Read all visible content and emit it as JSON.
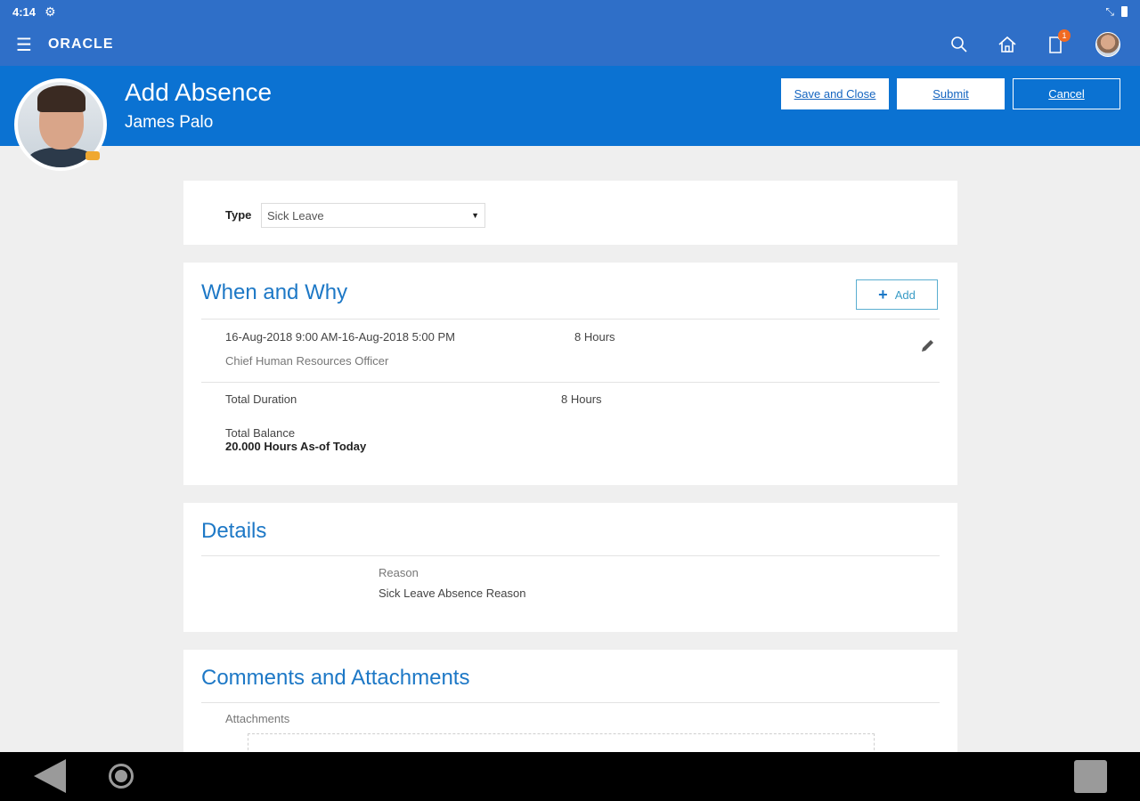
{
  "status_bar": {
    "time": "4:14"
  },
  "app_bar": {
    "logo": "ORACLE",
    "notification_count": "1"
  },
  "header": {
    "title": "Add Absence",
    "person_name": "James Palo",
    "buttons": {
      "save_close": "Save and Close",
      "submit": "Submit",
      "cancel": "Cancel"
    }
  },
  "type_section": {
    "label": "Type",
    "selected": "Sick Leave"
  },
  "when_why": {
    "title": "When and Why",
    "add_label": "Add",
    "entry": {
      "date_range": "16-Aug-2018 9:00 AM-16-Aug-2018 5:00 PM",
      "duration": "8 Hours",
      "role": "Chief Human Resources Officer"
    },
    "total_duration_label": "Total Duration",
    "total_duration_value": "8 Hours",
    "total_balance_label": "Total Balance",
    "total_balance_value": "20.000 Hours As-of Today"
  },
  "details": {
    "title": "Details",
    "reason_label": "Reason",
    "reason_value": "Sick Leave Absence Reason"
  },
  "comments": {
    "title": "Comments and Attachments",
    "attachments_label": "Attachments"
  },
  "colors": {
    "brand_blue": "#0b72d2",
    "topbar_blue": "#2f6fc8",
    "section_blue": "#1d78c6"
  }
}
